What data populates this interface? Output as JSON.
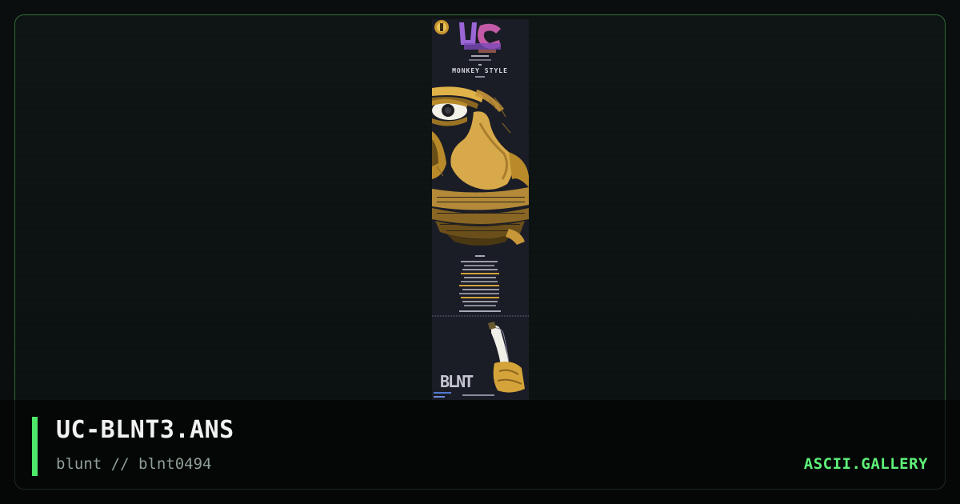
{
  "artwork": {
    "filename": "UC-BLNT3.ANS",
    "credits": "blunt // blnt0494",
    "embedded_text": {
      "header_title": "MONKEY STYLE",
      "footer_logo": "BLNT"
    }
  },
  "site": {
    "brand": "ASCII.GALLERY"
  },
  "colors": {
    "accent": "#4ee96a",
    "brand": "#5ff279",
    "card_border": "#2d6b33",
    "art_background": "#1b1d26"
  }
}
